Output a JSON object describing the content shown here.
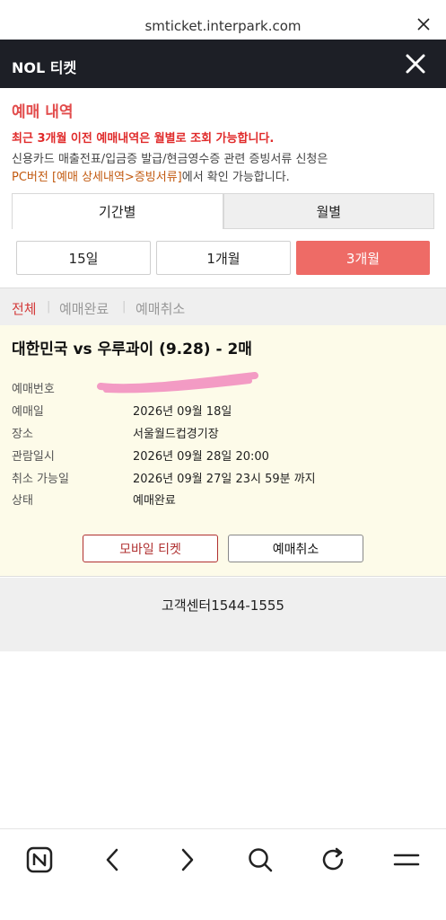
{
  "browser": {
    "url": "smticket.interpark.com"
  },
  "header": {
    "title": "NOL 티켓"
  },
  "intro": {
    "section_title": "예매 내역",
    "notice_red": "최근 3개월 이전 예매내역은 월별로 조회 가능합니다.",
    "notice_line1": "신용카드 매출전표/입금증 발급/현금영수증 관련 증빙서류 신청은",
    "notice_line2_highlight": "PC버전 [예매 상세내역>증빙서류]",
    "notice_line2_rest": "에서 확인 가능합니다."
  },
  "period_tabs": [
    {
      "label": "기간별",
      "active": true
    },
    {
      "label": "월별",
      "active": false
    }
  ],
  "range_buttons": [
    {
      "label": "15일",
      "active": false
    },
    {
      "label": "1개월",
      "active": false
    },
    {
      "label": "3개월",
      "active": true
    }
  ],
  "filters": [
    {
      "label": "전체",
      "active": true
    },
    {
      "label": "예매완료",
      "active": false
    },
    {
      "label": "예매취소",
      "active": false
    }
  ],
  "booking": {
    "title": "대한민국 vs 우루과이 (9.28) - 2매",
    "rows": [
      {
        "label": "예매번호",
        "value": ""
      },
      {
        "label": "예매일",
        "value": "2026년 09월 18일"
      },
      {
        "label": "장소",
        "value": "서울월드컵경기장"
      },
      {
        "label": "관람일시",
        "value": "2026년 09월 28일 20:00"
      },
      {
        "label": "취소 가능일",
        "value": "2026년 09월 27일 23시 59분 까지"
      },
      {
        "label": "상태",
        "value": "예매완료"
      }
    ],
    "mobile_ticket_label": "모바일 티켓",
    "cancel_label": "예매취소"
  },
  "footer": {
    "text": "고객센터1544-1555"
  },
  "bottom_nav": {
    "icons": [
      "naver-home-icon",
      "back-icon",
      "forward-icon",
      "search-icon",
      "refresh-icon",
      "menu-icon"
    ]
  },
  "colors": {
    "accent": "#ee6b66",
    "header_bg": "#1d1f26",
    "section_title": "#e24c4c",
    "card_bg": "#fdfbe9",
    "redaction": "#f39bc4"
  }
}
